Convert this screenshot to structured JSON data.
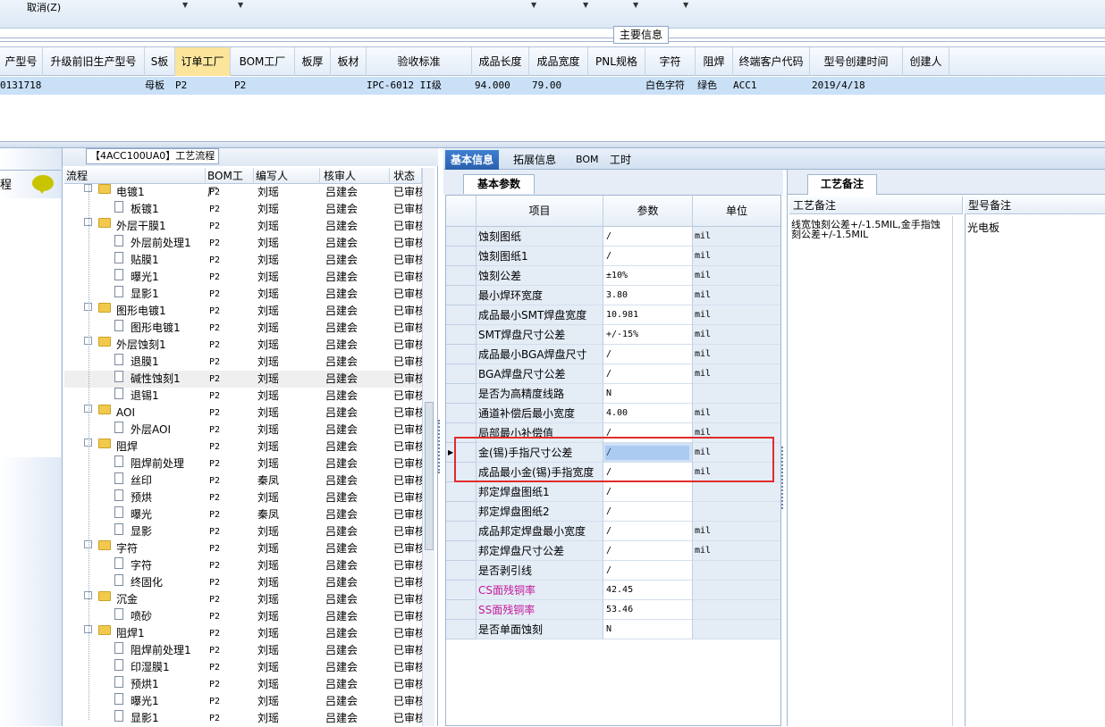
{
  "toolbar": {
    "cancel_label": "取消(Z)"
  },
  "main_info": {
    "title": "主要信息"
  },
  "header": {
    "columns": [
      "产型号",
      "升级前旧生产型号",
      "S板",
      "订单工厂",
      "BOM工厂",
      "板厚",
      "板材",
      "验收标准",
      "成品长度",
      "成品宽度",
      "PNL规格",
      "字符",
      "阻焊",
      "终端客户代码",
      "型号创建时间",
      "创建人"
    ],
    "selected": "订单工厂"
  },
  "record": {
    "model": "0131718",
    "s_board": "母板",
    "order_factory": "P2",
    "bom_factory": "P2",
    "standard": "IPC-6012 II级",
    "length": "94.000",
    "width": "79.00",
    "char": "白色字符",
    "solder": "绿色",
    "customer": "ACC1",
    "created": "2019/4/18"
  },
  "left_strip": {
    "label": "程"
  },
  "process": {
    "title": "【4ACC100UA0】工艺流程",
    "columns": [
      "流程",
      "BOM工厂",
      "编写人",
      "核审人",
      "状态"
    ],
    "rows": [
      {
        "name": "电镀1",
        "level": 0,
        "bom": "P2",
        "writer": "刘瑶",
        "reviewer": "吕建会",
        "status": "已审核"
      },
      {
        "name": "板镀1",
        "level": 1,
        "bom": "P2",
        "writer": "刘瑶",
        "reviewer": "吕建会",
        "status": "已审核"
      },
      {
        "name": "外层干膜1",
        "level": 0,
        "bom": "P2",
        "writer": "刘瑶",
        "reviewer": "吕建会",
        "status": "已审核"
      },
      {
        "name": "外层前处理1",
        "level": 1,
        "bom": "P2",
        "writer": "刘瑶",
        "reviewer": "吕建会",
        "status": "已审核"
      },
      {
        "name": "贴膜1",
        "level": 1,
        "bom": "P2",
        "writer": "刘瑶",
        "reviewer": "吕建会",
        "status": "已审核"
      },
      {
        "name": "曝光1",
        "level": 1,
        "bom": "P2",
        "writer": "刘瑶",
        "reviewer": "吕建会",
        "status": "已审核"
      },
      {
        "name": "显影1",
        "level": 1,
        "bom": "P2",
        "writer": "刘瑶",
        "reviewer": "吕建会",
        "status": "已审核"
      },
      {
        "name": "图形电镀1",
        "level": 0,
        "bom": "P2",
        "writer": "刘瑶",
        "reviewer": "吕建会",
        "status": "已审核"
      },
      {
        "name": "图形电镀1",
        "level": 1,
        "bom": "P2",
        "writer": "刘瑶",
        "reviewer": "吕建会",
        "status": "已审核"
      },
      {
        "name": "外层蚀刻1",
        "level": 0,
        "bom": "P2",
        "writer": "刘瑶",
        "reviewer": "吕建会",
        "status": "已审核"
      },
      {
        "name": "退膜1",
        "level": 1,
        "bom": "P2",
        "writer": "刘瑶",
        "reviewer": "吕建会",
        "status": "已审核"
      },
      {
        "name": "碱性蚀刻1",
        "level": 1,
        "bom": "P2",
        "writer": "刘瑶",
        "reviewer": "吕建会",
        "status": "已审核",
        "highlight": true
      },
      {
        "name": "退锡1",
        "level": 1,
        "bom": "P2",
        "writer": "刘瑶",
        "reviewer": "吕建会",
        "status": "已审核"
      },
      {
        "name": "AOI",
        "level": 0,
        "bom": "P2",
        "writer": "刘瑶",
        "reviewer": "吕建会",
        "status": "已审核"
      },
      {
        "name": "外层AOI",
        "level": 1,
        "bom": "P2",
        "writer": "刘瑶",
        "reviewer": "吕建会",
        "status": "已审核"
      },
      {
        "name": "阻焊",
        "level": 0,
        "bom": "P2",
        "writer": "刘瑶",
        "reviewer": "吕建会",
        "status": "已审核"
      },
      {
        "name": "阻焊前处理",
        "level": 1,
        "bom": "P2",
        "writer": "刘瑶",
        "reviewer": "吕建会",
        "status": "已审核"
      },
      {
        "name": "丝印",
        "level": 1,
        "bom": "P2",
        "writer": "秦凤",
        "reviewer": "吕建会",
        "status": "已审核"
      },
      {
        "name": "预烘",
        "level": 1,
        "bom": "P2",
        "writer": "刘瑶",
        "reviewer": "吕建会",
        "status": "已审核"
      },
      {
        "name": "曝光",
        "level": 1,
        "bom": "P2",
        "writer": "秦凤",
        "reviewer": "吕建会",
        "status": "已审核"
      },
      {
        "name": "显影",
        "level": 1,
        "bom": "P2",
        "writer": "刘瑶",
        "reviewer": "吕建会",
        "status": "已审核"
      },
      {
        "name": "字符",
        "level": 0,
        "bom": "P2",
        "writer": "刘瑶",
        "reviewer": "吕建会",
        "status": "已审核"
      },
      {
        "name": "字符",
        "level": 1,
        "bom": "P2",
        "writer": "刘瑶",
        "reviewer": "吕建会",
        "status": "已审核"
      },
      {
        "name": "终固化",
        "level": 1,
        "bom": "P2",
        "writer": "刘瑶",
        "reviewer": "吕建会",
        "status": "已审核"
      },
      {
        "name": "沉金",
        "level": 0,
        "bom": "P2",
        "writer": "刘瑶",
        "reviewer": "吕建会",
        "status": "已审核"
      },
      {
        "name": "喷砂",
        "level": 1,
        "bom": "P2",
        "writer": "刘瑶",
        "reviewer": "吕建会",
        "status": "已审核"
      },
      {
        "name": "阻焊1",
        "level": 0,
        "bom": "P2",
        "writer": "刘瑶",
        "reviewer": "吕建会",
        "status": "已审核"
      },
      {
        "name": "阻焊前处理1",
        "level": 1,
        "bom": "P2",
        "writer": "刘瑶",
        "reviewer": "吕建会",
        "status": "已审核"
      },
      {
        "name": "印湿膜1",
        "level": 1,
        "bom": "P2",
        "writer": "刘瑶",
        "reviewer": "吕建会",
        "status": "已审核"
      },
      {
        "name": "预烘1",
        "level": 1,
        "bom": "P2",
        "writer": "刘瑶",
        "reviewer": "吕建会",
        "status": "已审核"
      },
      {
        "name": "曝光1",
        "level": 1,
        "bom": "P2",
        "writer": "刘瑶",
        "reviewer": "吕建会",
        "status": "已审核"
      },
      {
        "name": "显影1",
        "level": 1,
        "bom": "P2",
        "writer": "刘瑶",
        "reviewer": "吕建会",
        "status": "已审核"
      }
    ]
  },
  "tabs": {
    "items": [
      "基本信息",
      "拓展信息",
      "BOM",
      "工时"
    ],
    "active": "基本信息"
  },
  "params": {
    "tab_label": "基本参数",
    "columns": [
      "项目",
      "参数",
      "单位"
    ],
    "rows": [
      {
        "item": "蚀刻图纸",
        "value": "/",
        "unit": "mil"
      },
      {
        "item": "蚀刻图纸1",
        "value": "/",
        "unit": "mil"
      },
      {
        "item": "蚀刻公差",
        "value": "±10%",
        "unit": "mil"
      },
      {
        "item": "最小焊环宽度",
        "value": "3.80",
        "unit": "mil"
      },
      {
        "item": "成品最小SMT焊盘宽度",
        "value": "10.981",
        "unit": "mil"
      },
      {
        "item": "SMT焊盘尺寸公差",
        "value": "+/-15%",
        "unit": "mil"
      },
      {
        "item": "成品最小BGA焊盘尺寸",
        "value": "/",
        "unit": "mil"
      },
      {
        "item": "BGA焊盘尺寸公差",
        "value": "/",
        "unit": "mil"
      },
      {
        "item": "是否为高精度线路",
        "value": "N",
        "unit": ""
      },
      {
        "item": "通道补偿后最小宽度",
        "value": "4.00",
        "unit": "mil"
      },
      {
        "item": "局部最小补偿值",
        "value": "/",
        "unit": "mil"
      },
      {
        "item": "金(锡)手指尺寸公差",
        "value": "/",
        "unit": "mil",
        "current": true
      },
      {
        "item": "成品最小金(锡)手指宽度",
        "value": "/",
        "unit": "mil"
      },
      {
        "item": "邦定焊盘图纸1",
        "value": "/",
        "unit": ""
      },
      {
        "item": "邦定焊盘图纸2",
        "value": "/",
        "unit": ""
      },
      {
        "item": "成品邦定焊盘最小宽度",
        "value": "/",
        "unit": "mil"
      },
      {
        "item": "邦定焊盘尺寸公差",
        "value": "/",
        "unit": "mil"
      },
      {
        "item": "是否剥引线",
        "value": "/",
        "unit": ""
      },
      {
        "item": "CS面残铜率",
        "value": "42.45",
        "unit": "",
        "pink": true
      },
      {
        "item": "SS面残铜率",
        "value": "53.46",
        "unit": "",
        "pink": true
      },
      {
        "item": "是否单面蚀刻",
        "value": "N",
        "unit": ""
      }
    ]
  },
  "process_notes": {
    "tab_label": "工艺备注",
    "col1": "工艺备注",
    "col2": "型号备注",
    "note": "线宽蚀刻公差+/-1.5MIL,金手指蚀刻公差+/-1.5MIL",
    "model_note": "光电板"
  },
  "colors": {
    "accent": "#2a5fae",
    "selected_header": "#fbe59b",
    "row_highlight": "#c9e0f7",
    "annotation": "#e02b2b",
    "pink_label": "#c21a9a"
  }
}
